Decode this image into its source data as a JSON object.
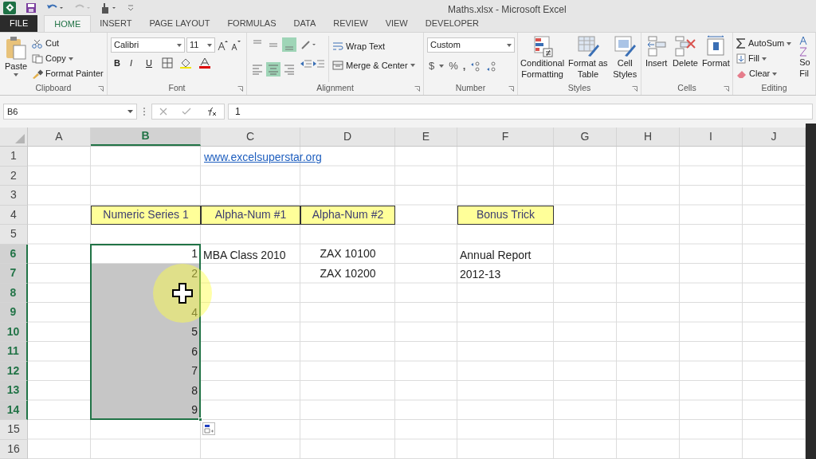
{
  "window": {
    "title": "Maths.xlsx - Microsoft Excel"
  },
  "tabs": [
    {
      "label": "FILE",
      "kind": "file",
      "selected": false
    },
    {
      "label": "HOME",
      "kind": "tab",
      "selected": true
    },
    {
      "label": "INSERT",
      "kind": "tab",
      "selected": false
    },
    {
      "label": "PAGE LAYOUT",
      "kind": "tab",
      "selected": false
    },
    {
      "label": "FORMULAS",
      "kind": "tab",
      "selected": false
    },
    {
      "label": "DATA",
      "kind": "tab",
      "selected": false
    },
    {
      "label": "REVIEW",
      "kind": "tab",
      "selected": false
    },
    {
      "label": "VIEW",
      "kind": "tab",
      "selected": false
    },
    {
      "label": "DEVELOPER",
      "kind": "tab",
      "selected": false
    }
  ],
  "clipboard": {
    "label": "Clipboard",
    "paste": "Paste",
    "cut": "Cut",
    "copy": "Copy",
    "format_painter": "Format Painter"
  },
  "font": {
    "label": "Font",
    "font_name": "Calibri",
    "font_size": "11",
    "bold": "B",
    "italic": "I",
    "underline": "U"
  },
  "alignment": {
    "label": "Alignment",
    "vertical_buttons": [
      {
        "selected": false
      },
      {
        "selected": false
      },
      {
        "selected": true
      }
    ],
    "horizontal_buttons": [
      {
        "selected": false
      },
      {
        "selected": true
      },
      {
        "selected": false
      }
    ],
    "wrap_text": "Wrap Text",
    "merge_center": "Merge & Center"
  },
  "number": {
    "label": "Number",
    "format": "Custom",
    "currency": "$",
    "percent": "%",
    "comma": ","
  },
  "styles": {
    "label": "Styles",
    "conditional": "Conditional Formatting",
    "format_table": "Format as Table",
    "cell_styles": "Cell Styles"
  },
  "cells": {
    "label": "Cells",
    "insert": "Insert",
    "delete": "Delete",
    "format": "Format"
  },
  "editing": {
    "label": "Editing",
    "autosum": "AutoSum",
    "fill": "Fill",
    "clear": "Clear",
    "sort_filter": [
      "So",
      "Fil"
    ]
  },
  "formula_bar": {
    "name_box": "B6",
    "value": "1"
  },
  "sheet": {
    "columns": [
      {
        "label": "A",
        "selected": false
      },
      {
        "label": "B",
        "selected": true
      },
      {
        "label": "C",
        "selected": false
      },
      {
        "label": "D",
        "selected": false
      },
      {
        "label": "E",
        "selected": false
      },
      {
        "label": "F",
        "selected": false
      },
      {
        "label": "G",
        "selected": false
      },
      {
        "label": "H",
        "selected": false
      },
      {
        "label": "I",
        "selected": false
      },
      {
        "label": "J",
        "selected": false
      }
    ],
    "rows": [
      {
        "label": "1",
        "selected": false,
        "cells": {
          "C": {
            "text": "www.excelsuperstar.org",
            "kind": "link"
          }
        }
      },
      {
        "label": "2",
        "selected": false,
        "cells": {}
      },
      {
        "label": "3",
        "selected": false,
        "cells": {}
      },
      {
        "label": "4",
        "selected": false,
        "cells": {
          "B": {
            "text": "Numeric Series 1",
            "kind": "header"
          },
          "C": {
            "text": "Alpha-Num #1",
            "kind": "header"
          },
          "D": {
            "text": "Alpha-Num #2",
            "kind": "header"
          },
          "F": {
            "text": "Bonus Trick",
            "kind": "header"
          }
        }
      },
      {
        "label": "5",
        "selected": false,
        "cells": {}
      },
      {
        "label": "6",
        "selected": true,
        "cells": {
          "B": {
            "text": "1",
            "kind": "number",
            "selected": false
          },
          "C": {
            "text": "MBA Class 2010",
            "kind": "text"
          },
          "D": {
            "text": "ZAX 10100",
            "kind": "centered"
          },
          "F": {
            "text": "Annual Report",
            "kind": "text"
          }
        }
      },
      {
        "label": "7",
        "selected": true,
        "cells": {
          "B": {
            "text": "2",
            "kind": "number",
            "selected": true
          },
          "D": {
            "text": "ZAX 10200",
            "kind": "centered"
          },
          "F": {
            "text": "2012-13",
            "kind": "text"
          }
        }
      },
      {
        "label": "8",
        "selected": true,
        "cells": {
          "B": {
            "kind": "number",
            "selected": true
          }
        }
      },
      {
        "label": "9",
        "selected": true,
        "cells": {
          "B": {
            "text": "4",
            "kind": "number",
            "selected": true
          }
        }
      },
      {
        "label": "10",
        "selected": true,
        "cells": {
          "B": {
            "text": "5",
            "kind": "number",
            "selected": true
          }
        }
      },
      {
        "label": "11",
        "selected": true,
        "cells": {
          "B": {
            "text": "6",
            "kind": "number",
            "selected": true
          }
        }
      },
      {
        "label": "12",
        "selected": true,
        "cells": {
          "B": {
            "text": "7",
            "kind": "number",
            "selected": true
          }
        }
      },
      {
        "label": "13",
        "selected": true,
        "cells": {
          "B": {
            "text": "8",
            "kind": "number",
            "selected": true
          }
        }
      },
      {
        "label": "14",
        "selected": true,
        "cells": {
          "B": {
            "text": "9",
            "kind": "number",
            "selected": true
          }
        }
      },
      {
        "label": "15",
        "selected": false,
        "cells": {}
      },
      {
        "label": "16",
        "selected": false,
        "cells": {}
      }
    ]
  }
}
